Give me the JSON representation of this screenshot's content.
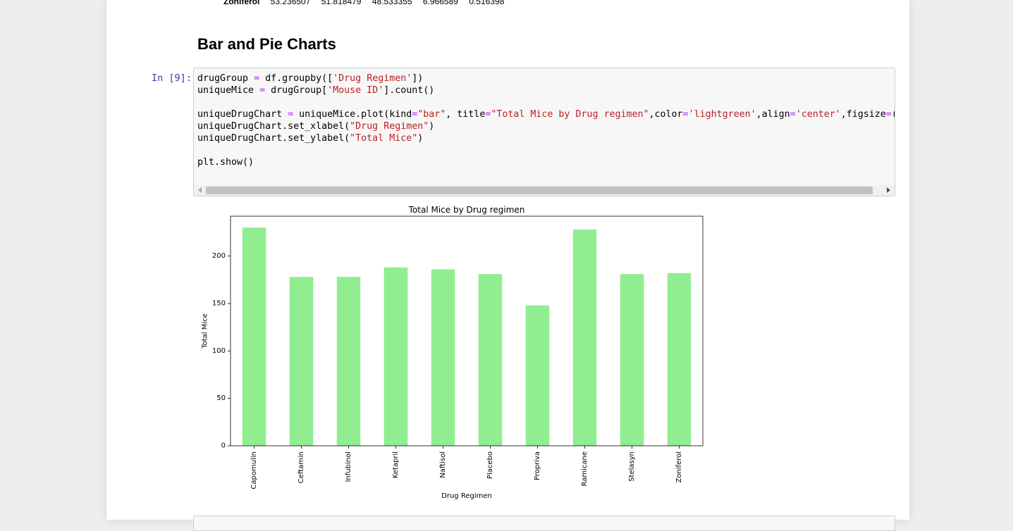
{
  "prev_output": {
    "index": "Zoniferol",
    "values": [
      "53.236507",
      "51.818479",
      "48.533355",
      "6.966589",
      "0.516398"
    ]
  },
  "heading": "Bar and Pie Charts",
  "cell": {
    "prompt": "In [9]:",
    "code": [
      [
        [
          "t",
          "drugGroup "
        ],
        [
          "o",
          "="
        ],
        [
          "t",
          " df.groupby(["
        ],
        [
          "s",
          "'Drug Regimen'"
        ],
        [
          "t",
          "])"
        ]
      ],
      [
        [
          "t",
          "uniqueMice "
        ],
        [
          "o",
          "="
        ],
        [
          "t",
          " drugGroup["
        ],
        [
          "s",
          "'Mouse ID'"
        ],
        [
          "t",
          "].count()"
        ]
      ],
      [
        [
          "t",
          ""
        ]
      ],
      [
        [
          "t",
          "uniqueDrugChart "
        ],
        [
          "o",
          "="
        ],
        [
          "t",
          " uniqueMice.plot(kind"
        ],
        [
          "o",
          "="
        ],
        [
          "s",
          "\"bar\""
        ],
        [
          "t",
          ", title"
        ],
        [
          "o",
          "="
        ],
        [
          "s",
          "\"Total Mice by Drug regimen\""
        ],
        [
          "t",
          ",color"
        ],
        [
          "o",
          "="
        ],
        [
          "s",
          "'lightgreen'"
        ],
        [
          "t",
          ",align"
        ],
        [
          "o",
          "="
        ],
        [
          "s",
          "'center'"
        ],
        [
          "t",
          ",figsize"
        ],
        [
          "o",
          "="
        ],
        [
          "t",
          "("
        ],
        [
          "n",
          "12"
        ],
        [
          "t",
          ","
        ],
        [
          "n",
          "6"
        ],
        [
          "t",
          ")"
        ]
      ],
      [
        [
          "t",
          "uniqueDrugChart.set_xlabel("
        ],
        [
          "s",
          "\"Drug Regimen\""
        ],
        [
          "t",
          ")"
        ]
      ],
      [
        [
          "t",
          "uniqueDrugChart.set_ylabel("
        ],
        [
          "s",
          "\"Total Mice\""
        ],
        [
          "t",
          ")"
        ]
      ],
      [
        [
          "t",
          ""
        ]
      ],
      [
        [
          "t",
          "plt.show()"
        ]
      ]
    ]
  },
  "chart_data": {
    "type": "bar",
    "title": "Total Mice by Drug regimen",
    "xlabel": "Drug Regimen",
    "ylabel": "Total Mice",
    "categories": [
      "Capomulin",
      "Ceftamin",
      "Infubinol",
      "Ketapril",
      "Naftisol",
      "Placebo",
      "Propriva",
      "Ramicane",
      "Stelasyn",
      "Zoniferol"
    ],
    "values": [
      230,
      178,
      178,
      188,
      186,
      181,
      148,
      228,
      181,
      182
    ],
    "yticks": [
      0,
      50,
      100,
      150,
      200
    ],
    "ylim": [
      0,
      242
    ],
    "color": "#90ee90",
    "grid": false,
    "legend": "none"
  }
}
